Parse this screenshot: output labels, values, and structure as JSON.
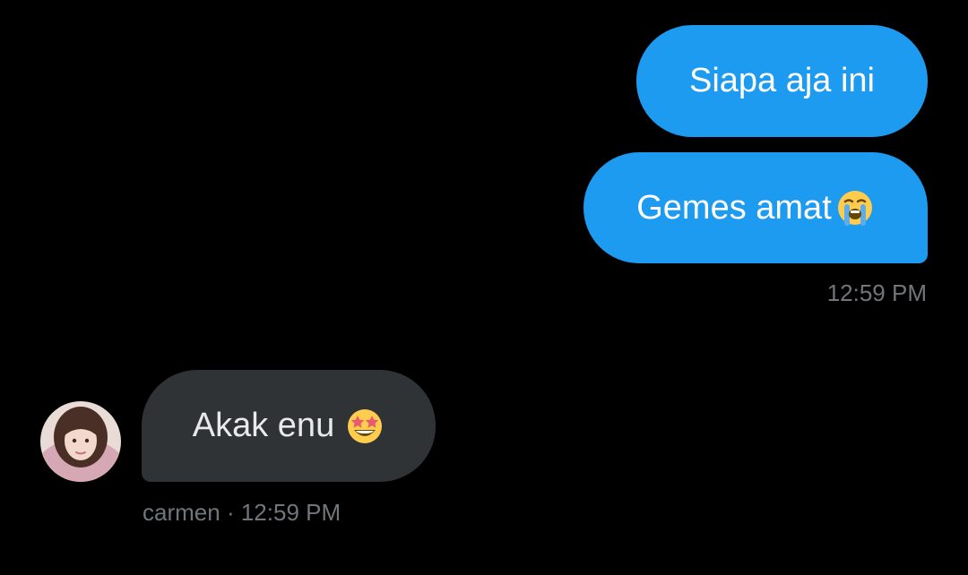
{
  "conversation": {
    "messages": [
      {
        "direction": "outgoing",
        "text": "Siapa aja ini"
      },
      {
        "direction": "outgoing",
        "text": "Gemes amat",
        "emoji": "loudly-crying-face-icon"
      },
      {
        "direction": "incoming",
        "text": "Akak enu",
        "emoji": "star-struck-face-icon"
      }
    ],
    "outgoing_timestamp": "12:59 PM",
    "incoming_meta": {
      "sender": "carmen",
      "separator": "·",
      "timestamp": "12:59 PM"
    }
  },
  "colors": {
    "background": "#000000",
    "outgoing_bubble": "#1d9bf0",
    "incoming_bubble": "#2f3336",
    "meta_text": "#71767b"
  }
}
